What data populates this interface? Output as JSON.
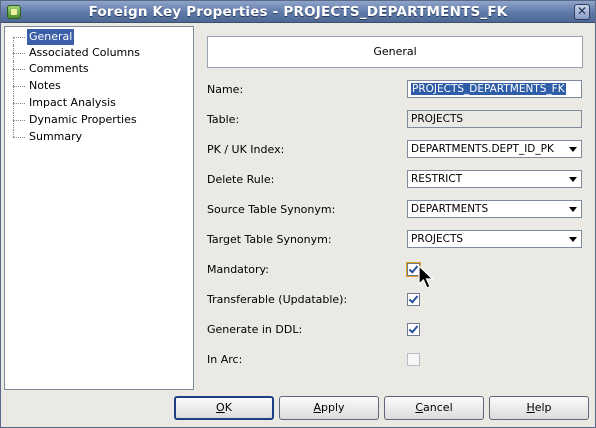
{
  "window": {
    "title": "Foreign Key Properties - PROJECTS_DEPARTMENTS_FK",
    "close_glyph": "✕"
  },
  "nav": {
    "items": [
      {
        "label": "General",
        "selected": true
      },
      {
        "label": "Associated Columns",
        "selected": false
      },
      {
        "label": "Comments",
        "selected": false
      },
      {
        "label": "Notes",
        "selected": false
      },
      {
        "label": "Impact Analysis",
        "selected": false
      },
      {
        "label": "Dynamic Properties",
        "selected": false
      },
      {
        "label": "Summary",
        "selected": false
      }
    ]
  },
  "section": {
    "header": "General"
  },
  "fields": {
    "name": {
      "label": "Name:",
      "value": "PROJECTS_DEPARTMENTS_FK"
    },
    "table": {
      "label": "Table:",
      "value": "PROJECTS"
    },
    "pk_index": {
      "label": "PK / UK Index:",
      "value": "DEPARTMENTS.DEPT_ID_PK"
    },
    "delete_rule": {
      "label": "Delete Rule:",
      "value": "RESTRICT"
    },
    "source_synonym": {
      "label": "Source Table Synonym:",
      "value": "DEPARTMENTS"
    },
    "target_synonym": {
      "label": "Target Table Synonym:",
      "value": "PROJECTS"
    },
    "mandatory": {
      "label": "Mandatory:",
      "checked": true
    },
    "transferable": {
      "label": "Transferable (Updatable):",
      "checked": true
    },
    "generate_ddl": {
      "label": "Generate in DDL:",
      "checked": true
    },
    "in_arc": {
      "label": "In Arc:",
      "checked": false,
      "enabled": false
    }
  },
  "buttons": {
    "ok": {
      "mnemonic": "O",
      "rest": "K"
    },
    "apply": {
      "mnemonic": "A",
      "rest": "pply"
    },
    "cancel": {
      "mnemonic": "C",
      "rest": "ancel"
    },
    "help": {
      "mnemonic": "H",
      "rest": "elp"
    }
  },
  "colors": {
    "title_bar": "#5f79a8",
    "selection": "#3b5ea8",
    "check_mark": "#2a4f9c"
  }
}
